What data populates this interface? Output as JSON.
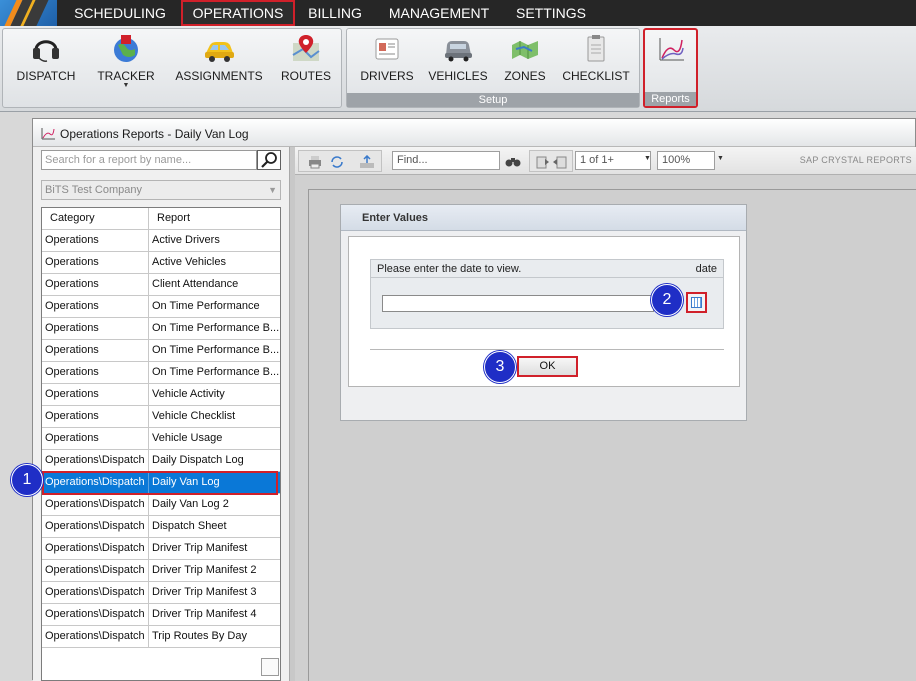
{
  "menu": {
    "items": [
      {
        "label": "SCHEDULING",
        "active": false
      },
      {
        "label": "OPERATIONS",
        "active": true
      },
      {
        "label": "BILLING",
        "active": false
      },
      {
        "label": "MANAGEMENT",
        "active": false
      },
      {
        "label": "SETTINGS",
        "active": false
      }
    ]
  },
  "ribbon": {
    "main": {
      "dispatch": "DISPATCH",
      "tracker": "TRACKER",
      "assignments": "ASSIGNMENTS",
      "routes": "ROUTES"
    },
    "setup": {
      "label": "Setup",
      "drivers": "DRIVERS",
      "vehicles": "VEHICLES",
      "zones": "ZONES",
      "checklist": "CHECKLIST"
    },
    "reports": {
      "label": "Reports"
    }
  },
  "window": {
    "title": "Operations Reports - Daily Van Log"
  },
  "left_pane": {
    "search_placeholder": "Search for a report by name...",
    "company": "BiTS Test Company",
    "columns": [
      "Category",
      "Report"
    ],
    "rows": [
      [
        "Operations",
        "Active Drivers"
      ],
      [
        "Operations",
        "Active Vehicles"
      ],
      [
        "Operations",
        "Client Attendance"
      ],
      [
        "Operations",
        "On Time Performance"
      ],
      [
        "Operations",
        "On Time Performance B..."
      ],
      [
        "Operations",
        "On Time Performance B..."
      ],
      [
        "Operations",
        "On Time Performance B..."
      ],
      [
        "Operations",
        "Vehicle Activity"
      ],
      [
        "Operations",
        "Vehicle Checklist"
      ],
      [
        "Operations",
        "Vehicle Usage"
      ],
      [
        "Operations\\Dispatch",
        "Daily Dispatch Log"
      ],
      [
        "Operations\\Dispatch",
        "Daily Van Log"
      ],
      [
        "Operations\\Dispatch",
        "Daily Van Log 2"
      ],
      [
        "Operations\\Dispatch",
        "Dispatch Sheet"
      ],
      [
        "Operations\\Dispatch",
        "Driver Trip Manifest"
      ],
      [
        "Operations\\Dispatch",
        "Driver Trip Manifest 2"
      ],
      [
        "Operations\\Dispatch",
        "Driver Trip Manifest 3"
      ],
      [
        "Operations\\Dispatch",
        "Driver Trip Manifest 4"
      ],
      [
        "Operations\\Dispatch",
        "Trip Routes By Day"
      ]
    ],
    "selected_index": 11
  },
  "viewer": {
    "find_placeholder": "Find...",
    "page": "1 of 1+",
    "zoom": "100%",
    "brand": "SAP CRYSTAL REPORTS"
  },
  "dialog": {
    "title": "Enter Values",
    "prompt": "Please enter the date to view.",
    "param_type": "date",
    "date_value": "",
    "ok_label": "OK"
  },
  "badges": {
    "one": "1",
    "two": "2",
    "three": "3"
  },
  "colors": {
    "highlight": "#d0202a",
    "selection": "#0a78d7",
    "badge": "#1f2ec6"
  }
}
